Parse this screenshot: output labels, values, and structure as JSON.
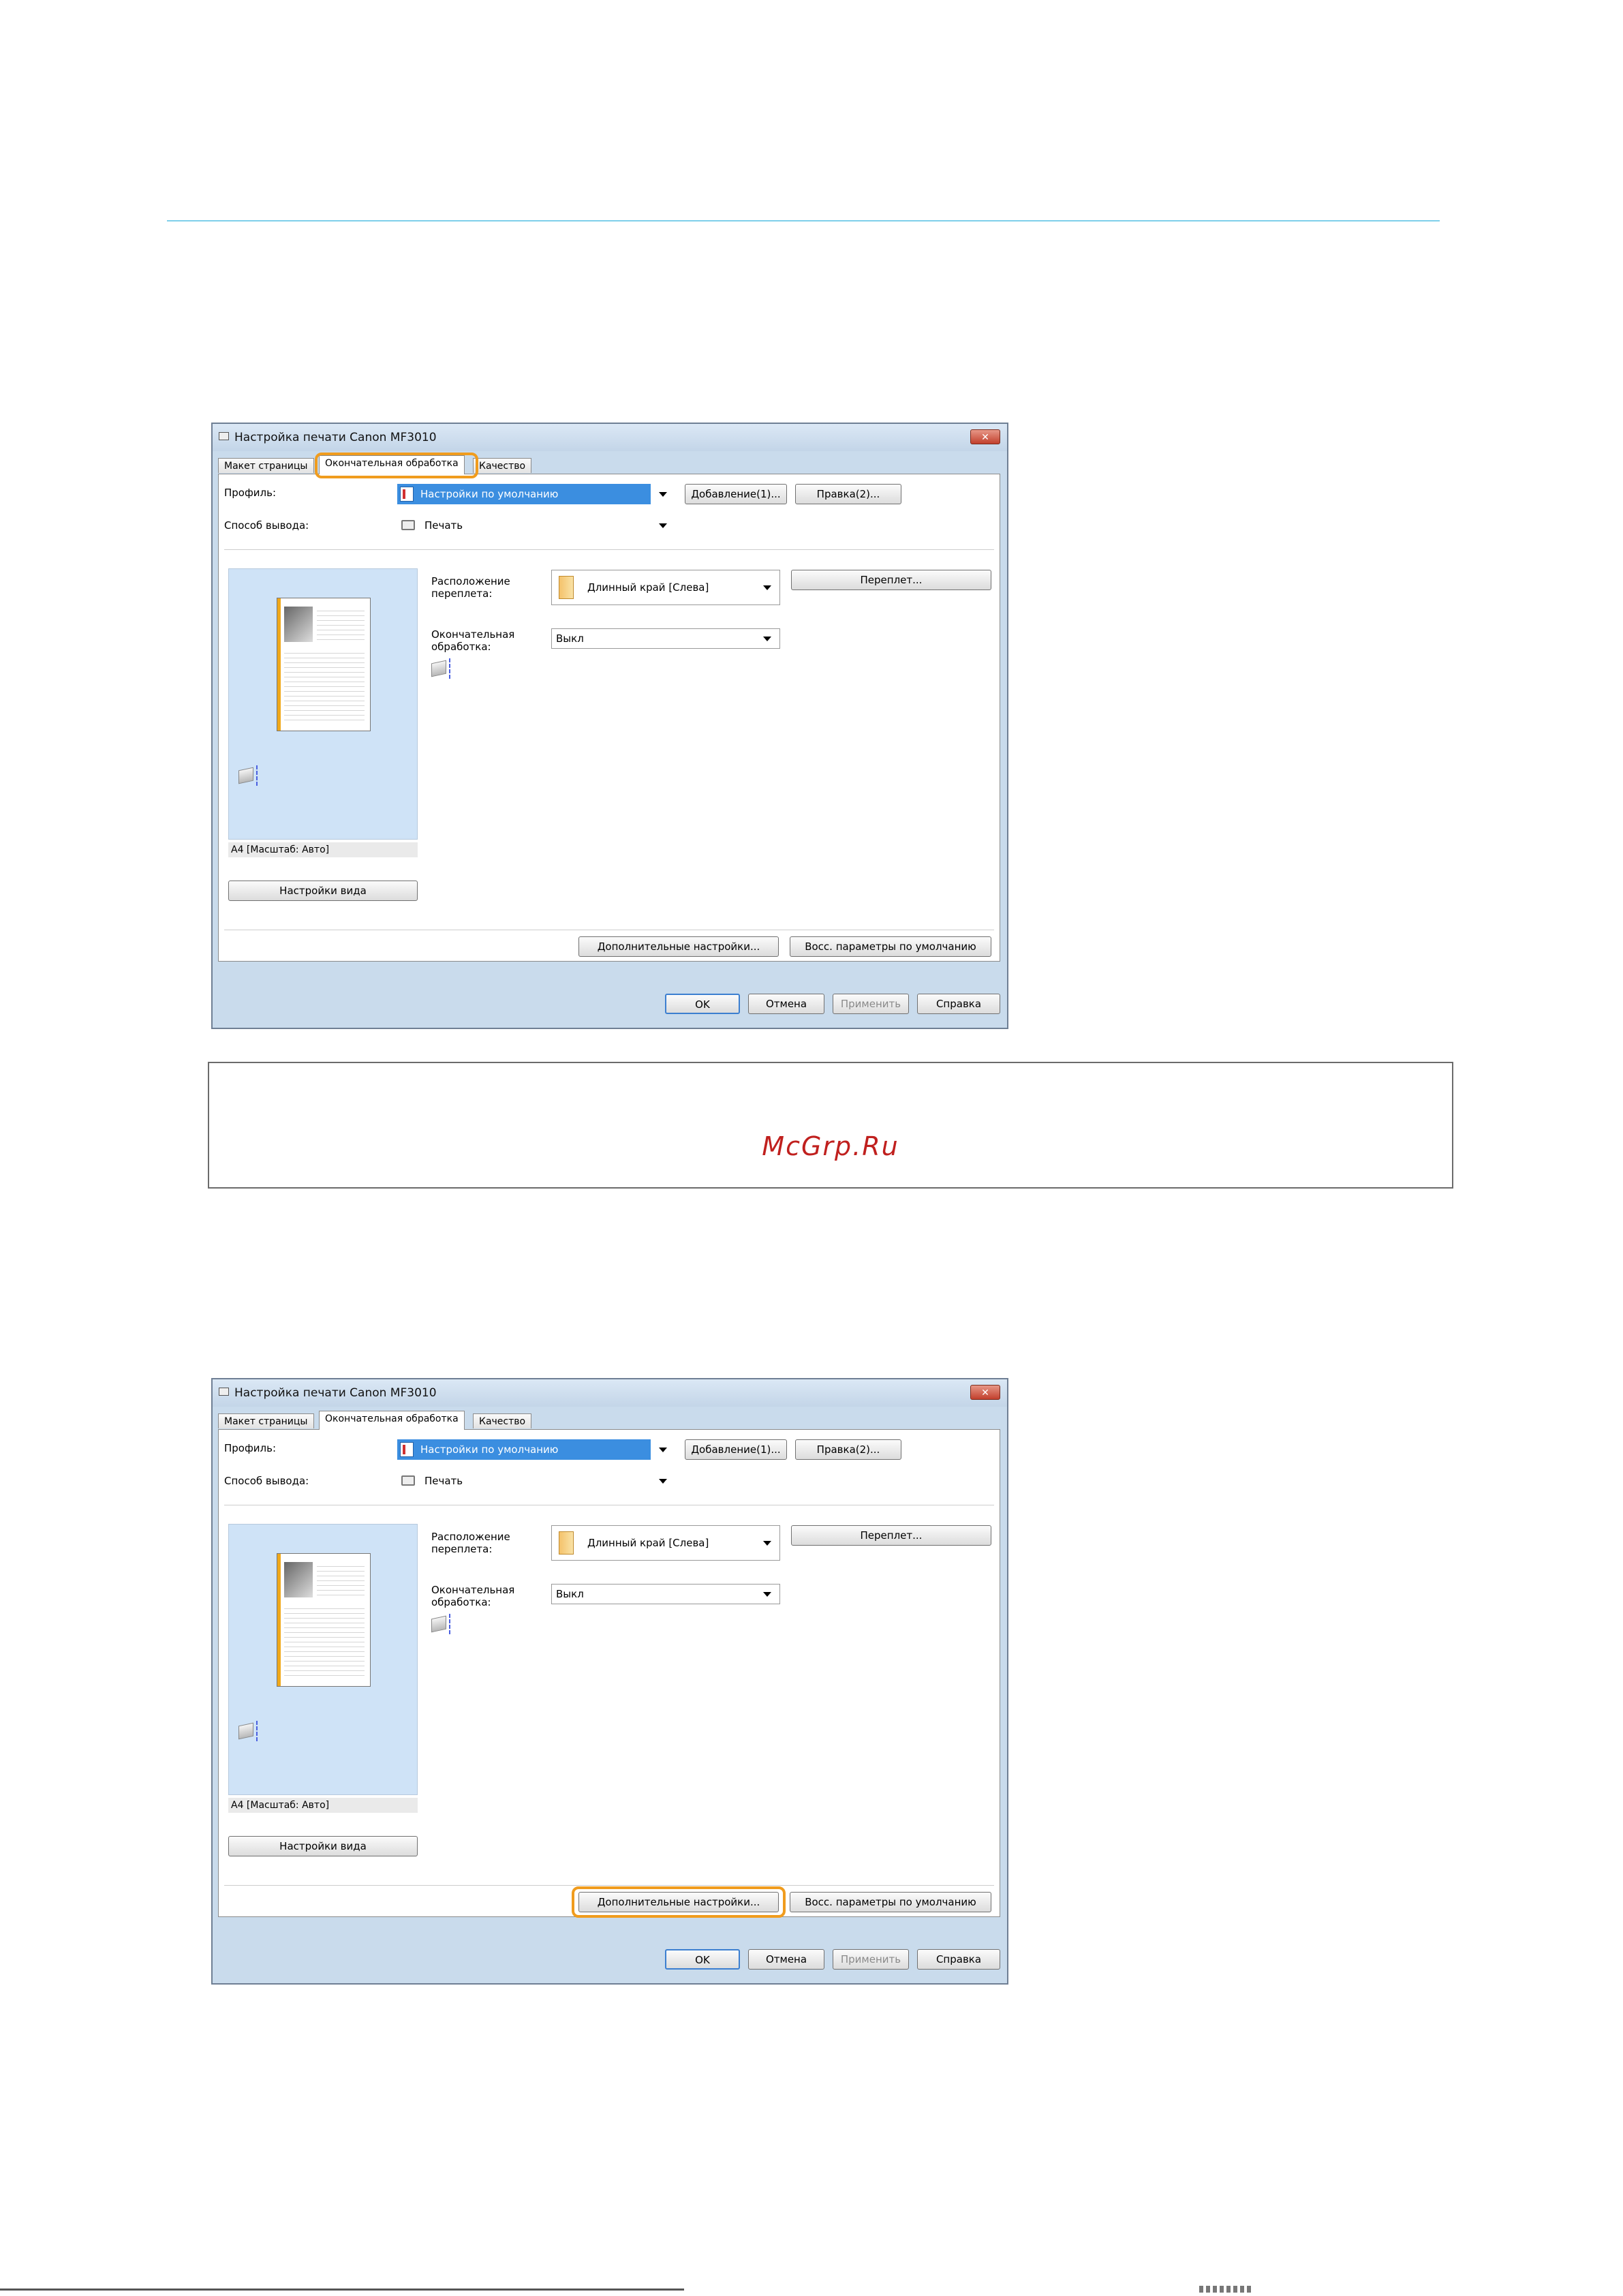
{
  "dialogs": [
    {
      "title": "Настройка печати Canon MF3010",
      "close_label": "✕",
      "tabs": [
        "Макет страницы",
        "Окончательная обработка",
        "Качество"
      ],
      "profile_label": "Профиль:",
      "profile_value": "Настройки по умолчанию",
      "add_button": "Добавление(1)...",
      "edit_button": "Правка(2)...",
      "output_label": "Способ вывода:",
      "output_value": "Печать",
      "binding_label_1": "Расположение",
      "binding_label_2": "переплета:",
      "binding_value": "Длинный край [Слева]",
      "binding_button": "Переплет...",
      "finishing_label_1": "Окончательная",
      "finishing_label_2": "обработка:",
      "finishing_value": "Выкл",
      "preview_caption": "A4 [Масштаб: Авто]",
      "view_settings_button": "Настройки вида",
      "advanced_button": "Дополнительные настройки...",
      "restore_button": "Восс. параметры по умолчанию",
      "ok_button": "OK",
      "cancel_button": "Отмена",
      "apply_button": "Применить",
      "help_button": "Справка",
      "highlight": "tab-finishing"
    },
    {
      "title": "Настройка печати Canon MF3010",
      "close_label": "✕",
      "tabs": [
        "Макет страницы",
        "Окончательная обработка",
        "Качество"
      ],
      "profile_label": "Профиль:",
      "profile_value": "Настройки по умолчанию",
      "add_button": "Добавление(1)...",
      "edit_button": "Правка(2)...",
      "output_label": "Способ вывода:",
      "output_value": "Печать",
      "binding_label_1": "Расположение",
      "binding_label_2": "переплета:",
      "binding_value": "Длинный край [Слева]",
      "binding_button": "Переплет...",
      "finishing_label_1": "Окончательная",
      "finishing_label_2": "обработка:",
      "finishing_value": "Выкл",
      "preview_caption": "A4 [Масштаб: Авто]",
      "view_settings_button": "Настройки вида",
      "advanced_button": "Дополнительные настройки...",
      "restore_button": "Восс. параметры по умолчанию",
      "ok_button": "OK",
      "cancel_button": "Отмена",
      "apply_button": "Применить",
      "help_button": "Справка",
      "highlight": "advanced-settings-button"
    }
  ],
  "note": {
    "watermark": "McGrp.Ru"
  },
  "colors": {
    "highlight": "#f09c1e",
    "rule": "#7ecfea",
    "selection": "#3b8ee0",
    "watermark": "#c0201e"
  }
}
